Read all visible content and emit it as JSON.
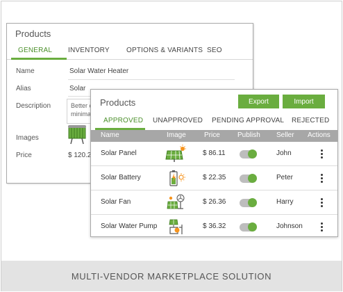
{
  "footer": {
    "caption": "MULTI-VENDOR MARKETPLACE SOLUTION"
  },
  "back_panel": {
    "title": "Products",
    "tabs": [
      "GENERAL",
      "INVENTORY",
      "OPTIONS & VARIANTS",
      "SEO"
    ],
    "active_tab": "GENERAL",
    "fields": {
      "name_label": "Name",
      "name_value": "Solar Water Heater",
      "alias_label": "Alias",
      "alias_value": "Solar",
      "description_label": "Description",
      "description_value_line1": "Better e",
      "description_value_line2": "minima",
      "images_label": "Images",
      "price_label": "Price",
      "price_value": "$ 120.24"
    }
  },
  "front_panel": {
    "title": "Products",
    "export_label": "Export",
    "import_label": "Import",
    "tabs": [
      "APPROVED",
      "UNAPPROVED",
      "PENDING APPROVAL",
      "REJECTED"
    ],
    "active_tab": "APPROVED",
    "columns": [
      "Name",
      "Image",
      "Price",
      "Publish",
      "Seller",
      "Actions"
    ],
    "rows": [
      {
        "name": "Solar Panel",
        "image_icon": "solar-panel-icon",
        "price": "$ 86.11",
        "published": true,
        "seller": "John"
      },
      {
        "name": "Solar Battery",
        "image_icon": "solar-battery-icon",
        "price": "$ 22.35",
        "published": true,
        "seller": "Peter"
      },
      {
        "name": "Solar Fan",
        "image_icon": "solar-fan-icon",
        "price": "$ 26.36",
        "published": true,
        "seller": "Harry"
      },
      {
        "name": "Solar Water Pump",
        "image_icon": "solar-water-pump-icon",
        "price": "$ 36.32",
        "published": true,
        "seller": "Johnson"
      }
    ]
  },
  "colors": {
    "accent": "#6aad3f",
    "header_gray": "#a7a7a7",
    "footer_band": "#e3e3e3"
  }
}
